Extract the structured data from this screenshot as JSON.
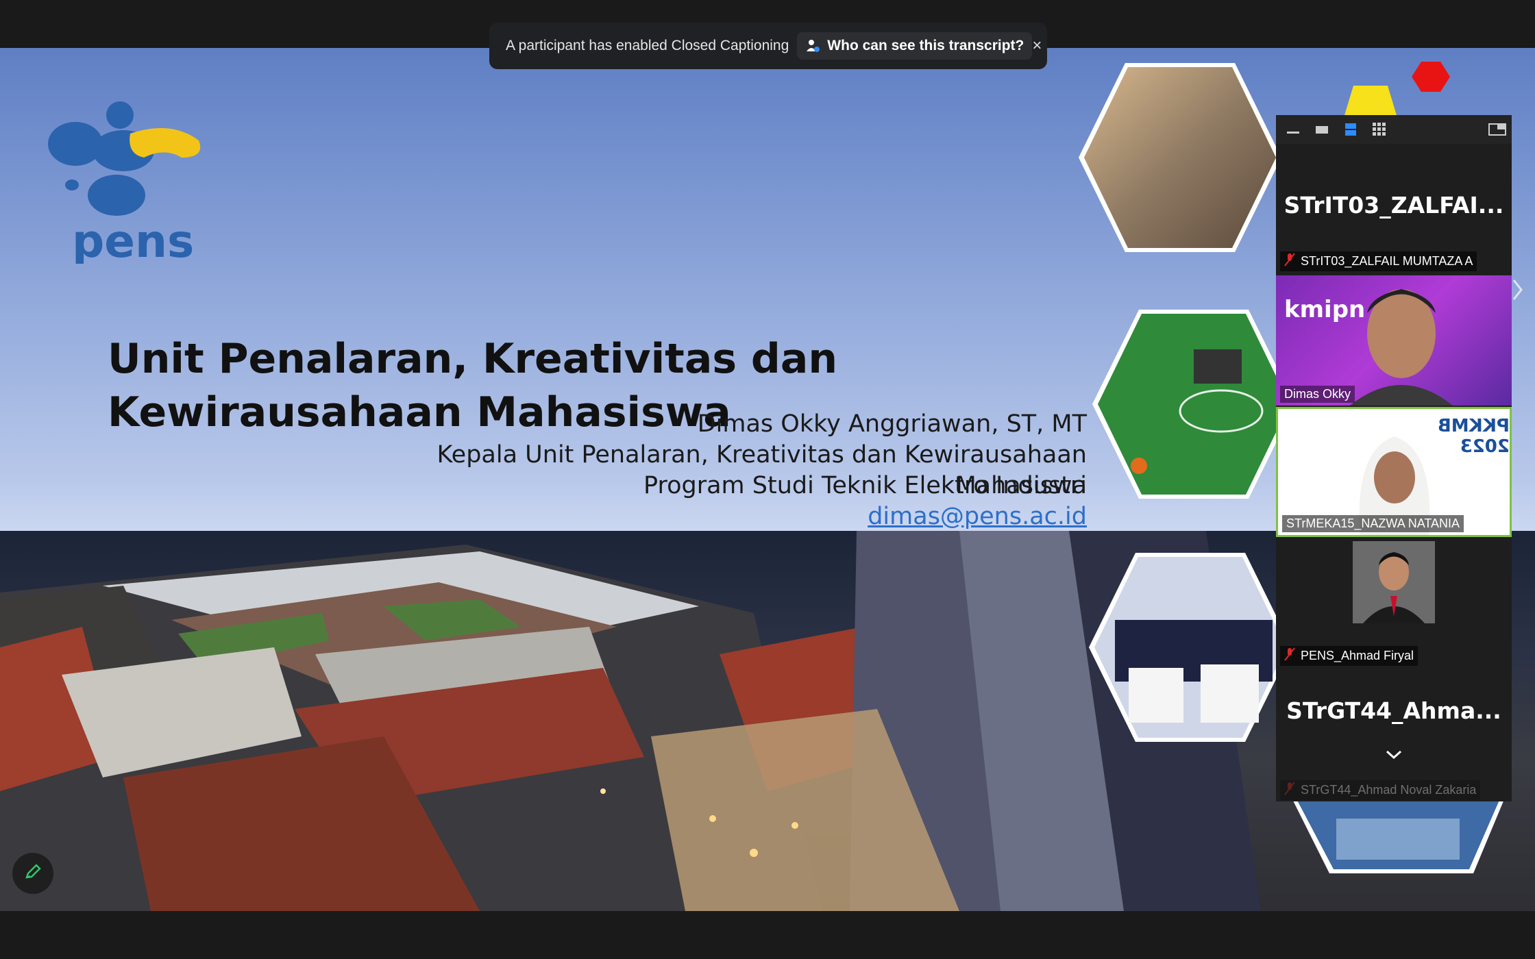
{
  "caption_banner": {
    "message": "A participant has enabled Closed Captioning",
    "who_label": "Who can see this transcript?",
    "close_icon": "×"
  },
  "slide": {
    "logo_text": "pens",
    "title": "Unit Penalaran, Kreativitas dan Kewirausahaan Mahasiswa",
    "presenter_name": "Dimas Okky Anggriawan, ST, MT",
    "presenter_role": "Kepala Unit Penalaran, Kreativitas dan Kewirausahaan Mahasiswa",
    "presenter_program": "Program Studi Teknik Elektro Industri",
    "presenter_email": "dimas@pens.ac.id"
  },
  "participants": [
    {
      "display": "STrIT03_ZALFAI...",
      "label": "STrIT03_ZALFAIL MUMTAZA A",
      "muted": true
    },
    {
      "display": "",
      "label": "Dimas Okky",
      "muted": false,
      "bg_text": "kmipn"
    },
    {
      "display": "",
      "label": "STrMEKA15_NAZWA NATANIA",
      "muted": false,
      "bg_text": "PKKMB 2023"
    },
    {
      "display": "",
      "label": "PENS_Ahmad Firyal",
      "muted": true
    },
    {
      "display": "STrGT44_Ahma...",
      "label": "STrGT44_Ahmad Noval Zakaria",
      "muted": true
    }
  ],
  "colors": {
    "active_speaker_border": "#7fc241",
    "accent_blue": "#2d8cff",
    "muted_red": "#e02828"
  }
}
